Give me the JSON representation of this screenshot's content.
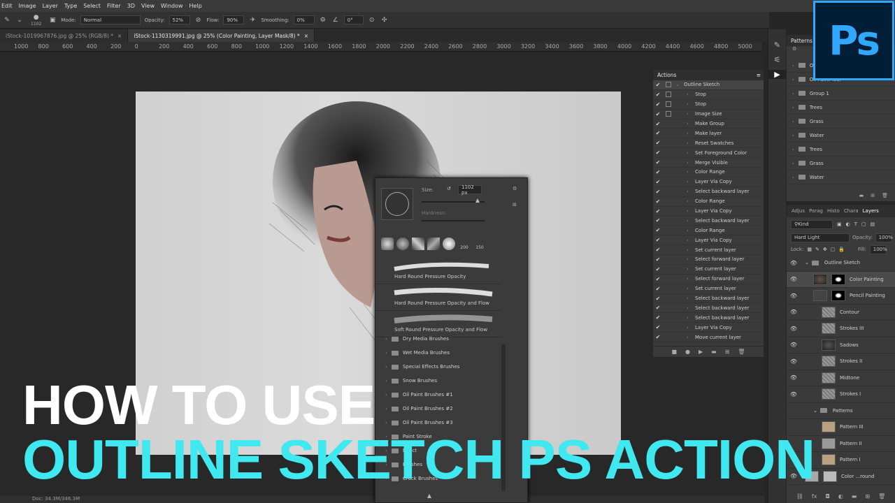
{
  "menu": [
    "Edit",
    "Image",
    "Layer",
    "Type",
    "Select",
    "Filter",
    "3D",
    "View",
    "Window",
    "Help"
  ],
  "options": {
    "brush_size": "1102",
    "mode_label": "Mode:",
    "mode_value": "Normal",
    "opacity_label": "Opacity:",
    "opacity_value": "52%",
    "flow_label": "Flow:",
    "flow_value": "90%",
    "smoothing_label": "Smoothing:",
    "smoothing_value": "0%",
    "angle_value": "0°"
  },
  "tabs": [
    {
      "label": "iStock-1019967876.jpg @ 25% (RGB/8) *",
      "active": false
    },
    {
      "label": "iStock-1130319991.jpg @ 25% (Color Painting, Layer Mask/8) *",
      "active": true
    }
  ],
  "ruler": [
    "1000",
    "800",
    "600",
    "400",
    "200",
    "0",
    "200",
    "400",
    "600",
    "800",
    "1000",
    "1200",
    "1400",
    "1600",
    "1800",
    "2000",
    "2200",
    "2400",
    "2600",
    "2800",
    "3000",
    "3200",
    "3400",
    "3600",
    "3800",
    "4000",
    "4200",
    "4400",
    "4600",
    "4800",
    "5000"
  ],
  "status": "Doc: 34.3M/346.3M",
  "actions": {
    "title": "Actions",
    "set": "Outline Sketch",
    "items": [
      {
        "label": "Stop",
        "box": true
      },
      {
        "label": "Stop",
        "box": true
      },
      {
        "label": "Image Size",
        "box": true
      },
      {
        "label": "Make Group",
        "box": false
      },
      {
        "label": "Make layer",
        "box": false
      },
      {
        "label": "Reset Swatches",
        "box": false
      },
      {
        "label": "Set Foreground Color",
        "box": false
      },
      {
        "label": "Merge Visible",
        "box": false
      },
      {
        "label": "Color Range",
        "box": false
      },
      {
        "label": "Layer Via Copy",
        "box": false
      },
      {
        "label": "Select backward layer",
        "box": false
      },
      {
        "label": "Color Range",
        "box": false
      },
      {
        "label": "Layer Via Copy",
        "box": false
      },
      {
        "label": "Select backward layer",
        "box": false
      },
      {
        "label": "Color Range",
        "box": false
      },
      {
        "label": "Layer Via Copy",
        "box": false
      },
      {
        "label": "Set current layer",
        "box": false
      },
      {
        "label": "Select forward layer",
        "box": false
      },
      {
        "label": "Set current layer",
        "box": false
      },
      {
        "label": "Select forward layer",
        "box": false
      },
      {
        "label": "Set current layer",
        "box": false
      },
      {
        "label": "Select backward layer",
        "box": false
      },
      {
        "label": "Select backward layer",
        "box": false
      },
      {
        "label": "Select backward layer",
        "box": false
      },
      {
        "label": "Layer Via Copy",
        "box": false
      },
      {
        "label": "Move current layer",
        "box": false
      }
    ]
  },
  "brush": {
    "size_label": "Size:",
    "size_value": "1102 px",
    "hardness_label": "Hardness:",
    "preset_nums": [
      "200",
      "150"
    ],
    "strokes": [
      "Hard Round Pressure Opacity",
      "Hard Round Pressure Opacity and Flow",
      "Soft Round Pressure Opacity and Flow"
    ],
    "folders": [
      "Dry Media Brushes",
      "Wet Media Brushes",
      "Special Effects Brushes",
      "Snow Brushes",
      "Oil Paint Brushes #1",
      "Oil Paint Brushes #2",
      "Oil Paint Brushes #3",
      "Paint Stroke",
      "Effect",
      "Brushes",
      "Crack Brushes"
    ]
  },
  "patterns": {
    "title": "Patterns",
    "items": [
      "Oil",
      "Oil Paint Tool",
      "Group 1",
      "Trees",
      "Grass",
      "Water",
      "Trees",
      "Grass",
      "Water"
    ]
  },
  "layers": {
    "tabs": [
      "Adjus",
      "Parag",
      "Histo",
      "Chara",
      "Layers"
    ],
    "kind": "Kind",
    "blend": "Hard Light",
    "opacity_label": "Opacity:",
    "opacity": "100%",
    "lock_label": "Lock:",
    "fill_label": "Fill:",
    "fill": "100%",
    "rows": [
      {
        "name": "Outline Sketch",
        "type": "group",
        "indent": 0,
        "eye": true
      },
      {
        "name": "Color Painting",
        "type": "masked",
        "indent": 1,
        "eye": true,
        "selected": true
      },
      {
        "name": "Pencil Painting",
        "type": "group-masked",
        "indent": 1,
        "eye": true
      },
      {
        "name": "Contour",
        "type": "checker",
        "indent": 2,
        "eye": true
      },
      {
        "name": "Strokes III",
        "type": "checker",
        "indent": 2,
        "eye": true
      },
      {
        "name": "Sadows",
        "type": "dark",
        "indent": 2,
        "eye": true
      },
      {
        "name": "Strokes II",
        "type": "checker",
        "indent": 2,
        "eye": true
      },
      {
        "name": "Midtone",
        "type": "checker",
        "indent": 2,
        "eye": true
      },
      {
        "name": "Strokes I",
        "type": "checker",
        "indent": 2,
        "eye": true
      },
      {
        "name": "Patterns",
        "type": "group",
        "indent": 1,
        "eye": false
      },
      {
        "name": "Pattern III",
        "type": "tan",
        "indent": 2,
        "eye": false
      },
      {
        "name": "Pattern II",
        "type": "grey",
        "indent": 2,
        "eye": false
      },
      {
        "name": "Pattern I",
        "type": "tan",
        "indent": 2,
        "eye": false
      },
      {
        "name": "Color ...round",
        "type": "bg",
        "indent": 0,
        "eye": true
      }
    ]
  },
  "logo": "Ps",
  "headline1": "HOW TO USE",
  "headline2": "OUTLINE SKETCH PS ACTION"
}
